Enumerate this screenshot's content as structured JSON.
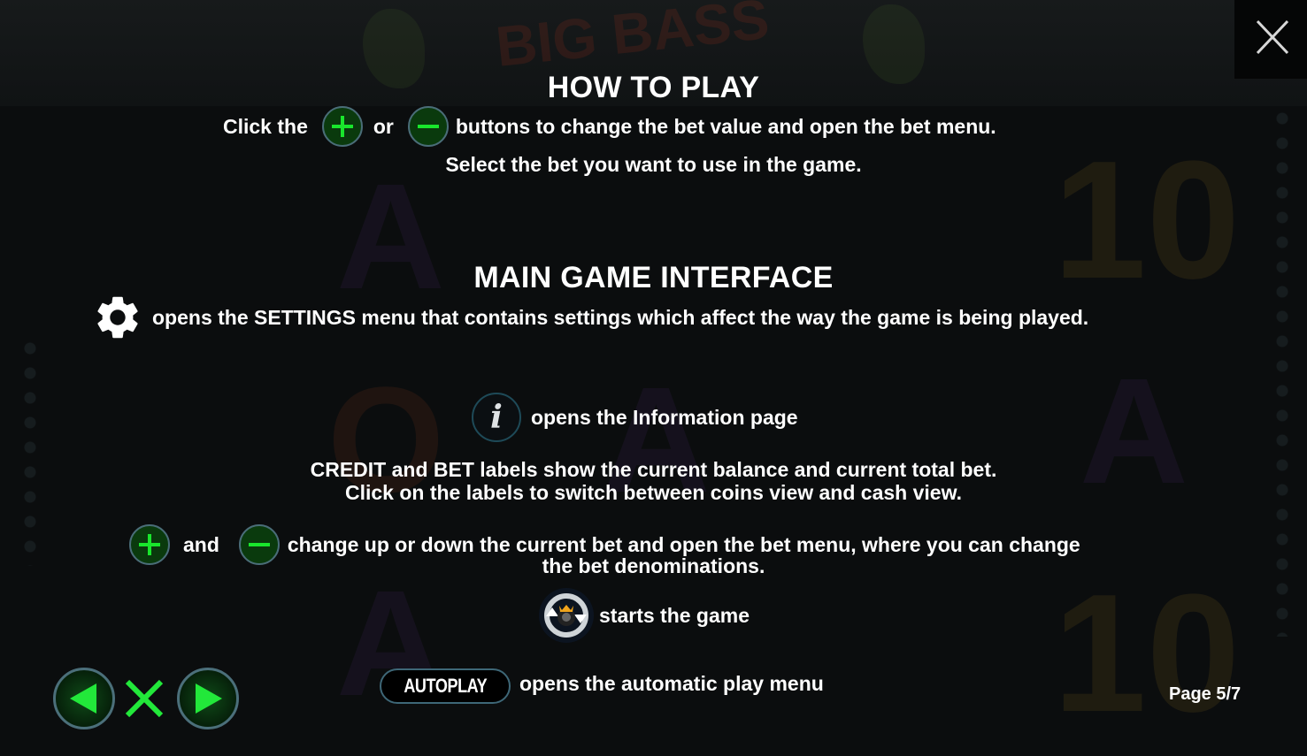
{
  "colors": {
    "background": "#0b0d0e",
    "text": "#ffffff",
    "accent_green": "#19e62c",
    "button_fill": "#0a3a0d",
    "button_border": "#4a6d78"
  },
  "close_button": {
    "icon": "close-icon"
  },
  "how_to_play": {
    "title": "HOW TO PLAY",
    "line1_prefix": "Click the",
    "line1_or": "or",
    "line1_suffix": "buttons to change the bet value and open the bet menu.",
    "line2": "Select the bet you want to use in the game."
  },
  "main_interface": {
    "title": "MAIN GAME INTERFACE",
    "settings_text": "opens the SETTINGS menu that contains settings which affect the way the game is being played.",
    "info_text": "opens the Information page",
    "credit_line1": "CREDIT and BET labels show the current balance and current total bet.",
    "credit_line2": "Click on the labels to switch between coins view and cash view.",
    "bet_and": "and",
    "bet_line1": "change up or down the current bet and open the bet menu, where you can change",
    "bet_line2": "the bet denominations.",
    "spin_text": "starts the game",
    "autoplay_label": "AUTOPLAY",
    "autoplay_text": "opens the automatic play menu"
  },
  "icons": {
    "plus": "plus-icon",
    "minus": "minus-icon",
    "settings": "gear-icon",
    "info": "info-icon",
    "info_glyph": "i",
    "spin": "spin-icon"
  },
  "navigation": {
    "prev": "previous-page",
    "close": "close-help",
    "next": "next-page",
    "current_page": 5,
    "total_pages": 7,
    "page_label": "Page 5/7"
  }
}
